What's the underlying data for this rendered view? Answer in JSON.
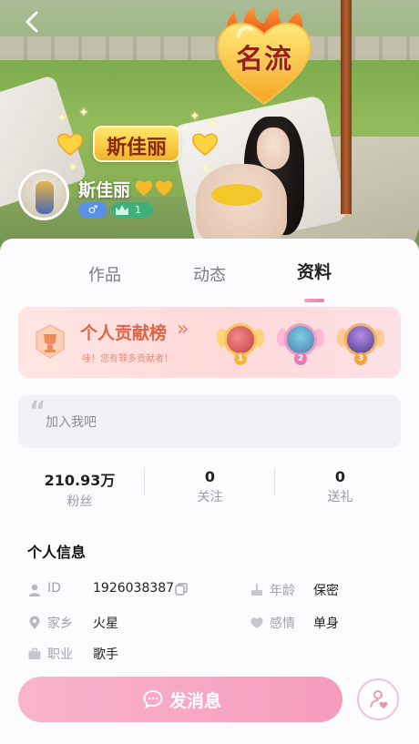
{
  "header": {
    "back_icon": "chevron-left-icon",
    "fame_badge_text": "名流",
    "banner_name": "斯佳丽"
  },
  "profile": {
    "name": "斯佳丽",
    "gender_symbol": "♂",
    "level": "1"
  },
  "tabs": [
    {
      "label": "作品",
      "active": false
    },
    {
      "label": "动态",
      "active": false
    },
    {
      "label": "资料",
      "active": true
    }
  ],
  "contribution": {
    "title": "个人贡献榜",
    "chevron": "»",
    "subtitle": "哇！您有罪多贡献者！",
    "ranks": [
      {
        "rank": "1",
        "color": "#f2b640"
      },
      {
        "rank": "2",
        "color": "#e87cb0"
      },
      {
        "rank": "3",
        "color": "#f3a23c"
      }
    ]
  },
  "bio": {
    "quote_glyph": "“",
    "text": "加入我吧"
  },
  "stats": [
    {
      "value": "210.93万",
      "label": "粉丝"
    },
    {
      "value": "0",
      "label": "关注"
    },
    {
      "value": "0",
      "label": "送礼"
    }
  ],
  "info": {
    "title": "个人信息",
    "id_label": "ID",
    "id_value": "1926038387",
    "age_label": "年龄",
    "age_value": "保密",
    "hometown_label": "家乡",
    "hometown_value": "火星",
    "relationship_label": "感情",
    "relationship_value": "单身",
    "job_label": "职业",
    "job_value": "歌手"
  },
  "actions": {
    "message_label": "发消息",
    "accent": "#f59cbd"
  }
}
